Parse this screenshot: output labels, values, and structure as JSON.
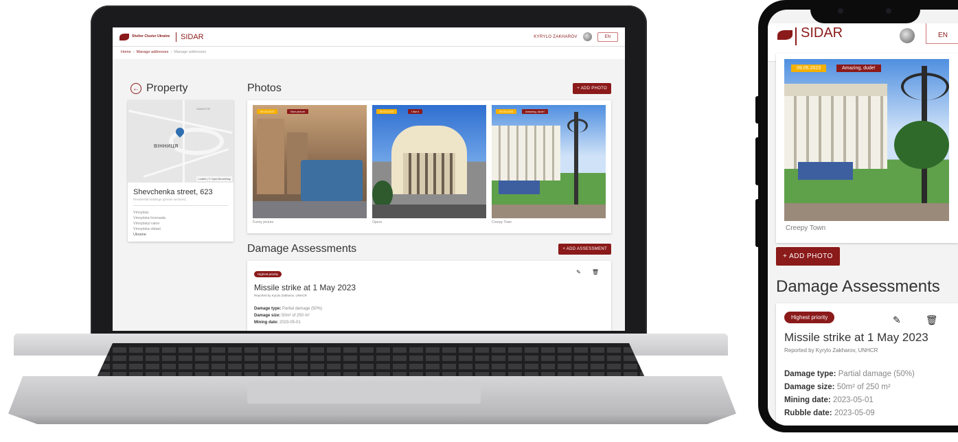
{
  "laptop_app": {
    "logo_text": "Shelter Cluster Ukraine",
    "app_name": "SIDAR",
    "user_name": "KYRYLO ZAKHAROV",
    "lang": "EN",
    "breadcrumb": [
      "Home",
      "Manage addresses",
      "Manage addresses"
    ],
    "property": {
      "title": "Property",
      "map_city": "ВІННИЦЯ",
      "map_district": "ЗАМОСТЯ",
      "map_attribution": "Leaflet | © OpenStreetMap",
      "address": "Shevchenka street, 623",
      "subtitle": "Residential buildings (private sections)",
      "lines": [
        "Vinnytsia",
        "Vinnytska hromada",
        "Vinnytskyi raion",
        "Vinnytska oblast",
        "Ukraine"
      ]
    },
    "photos": {
      "title": "Photos",
      "add_label": "+ ADD PHOTO",
      "items": [
        {
          "date": "09.05.2023",
          "tag": "Nice picture",
          "caption": "Funny picture"
        },
        {
          "date": "09.05.2023",
          "tag": "I like it",
          "caption": "Opera"
        },
        {
          "date": "09.05.2023",
          "tag": "Amazing, dude!",
          "caption": "Creepy Town"
        }
      ]
    },
    "assessments": {
      "title": "Damage Assessments",
      "add_label": "+ ADD ASSESSMENT",
      "item": {
        "priority": "Highest priority",
        "title": "Missile strike at 1 May 2023",
        "reported": "Reported by Kyrylo Zakharov, UNHCR",
        "damage_type_label": "Damage type:",
        "damage_type": "Partial damage (50%)",
        "damage_size_label": "Damage size:",
        "damage_size": "50m² of 250 m²",
        "mining_label": "Mining date:",
        "mining": "2023-05-01"
      }
    }
  },
  "phone_app": {
    "app_name": "SIDAR",
    "lang": "EN",
    "photo": {
      "date": "09.05.2023",
      "tag": "Amazing, dude!",
      "caption": "Creepy Town"
    },
    "add_photo": "+ ADD PHOTO",
    "assessments_title": "Damage Assessments",
    "item": {
      "priority": "Highest priority",
      "title": "Missile strike at 1 May 2023",
      "reported": "Reported by Kyrylo Zakharov, UNHCR",
      "damage_type_label": "Damage type:",
      "damage_type": "Partial damage (50%)",
      "damage_size_label": "Damage size:",
      "damage_size": "50m² of 250 m²",
      "mining_label": "Mining date:",
      "mining": "2023-05-01",
      "rubble_label": "Rubble date:",
      "rubble": "2023-05-09"
    }
  },
  "colors": {
    "brand": "#8b1a1a",
    "date_chip": "#f5b000"
  },
  "icons": [
    "arrow-back-icon",
    "map-pin-icon",
    "edit-icon",
    "delete-icon",
    "plus-icon"
  ]
}
